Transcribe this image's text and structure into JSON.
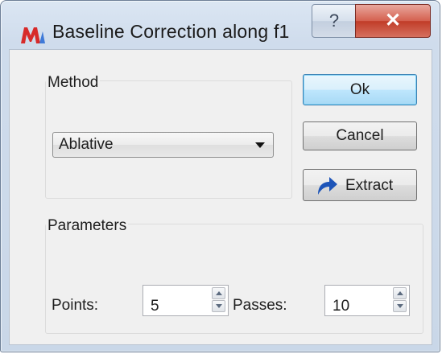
{
  "window": {
    "title": "Baseline Correction along f1",
    "help_label": "?",
    "close_label": "✕"
  },
  "method": {
    "group_title": "Method",
    "selected": "Ablative"
  },
  "buttons": {
    "ok_label": "Ok",
    "cancel_label": "Cancel",
    "extract_label": "Extract"
  },
  "parameters": {
    "group_title": "Parameters",
    "points_label": "Points:",
    "points_value": "5",
    "passes_label": "Passes:",
    "passes_value": "10"
  },
  "icons": {
    "app": "m-logo-icon",
    "extract": "curved-arrow-icon"
  },
  "colors": {
    "close_red": "#c13c28",
    "ok_focus_blue": "#3c7fb1",
    "logo_red": "#d72a2a",
    "extract_arrow_blue": "#1d54b8"
  }
}
